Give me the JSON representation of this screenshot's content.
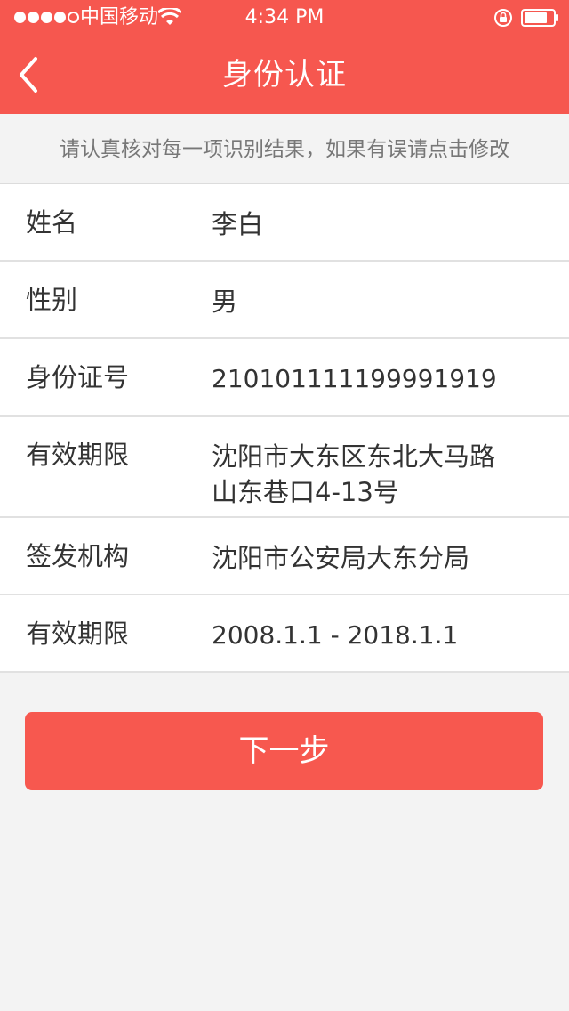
{
  "status_bar": {
    "carrier": "中国移动",
    "time": "4:34 PM"
  },
  "nav": {
    "title": "身份认证"
  },
  "hint": "请认真核对每一项识别结果，如果有误请点击修改",
  "fields": [
    {
      "label": "姓名",
      "value": "李白"
    },
    {
      "label": "性别",
      "value": "男"
    },
    {
      "label": "身份证号",
      "value": "210101111199991919"
    },
    {
      "label": "有效期限",
      "value_lines": [
        "沈阳市大东区东北大马路",
        "山东巷口4-13号"
      ]
    },
    {
      "label": "签发机构",
      "value": "沈阳市公安局大东分局"
    },
    {
      "label": "有效期限",
      "value": "2008.1.1 - 2018.1.1"
    }
  ],
  "next_button": "下一步",
  "colors": {
    "brand": "#f6574f",
    "button": "#f7584f",
    "background": "#f3f3f3"
  }
}
